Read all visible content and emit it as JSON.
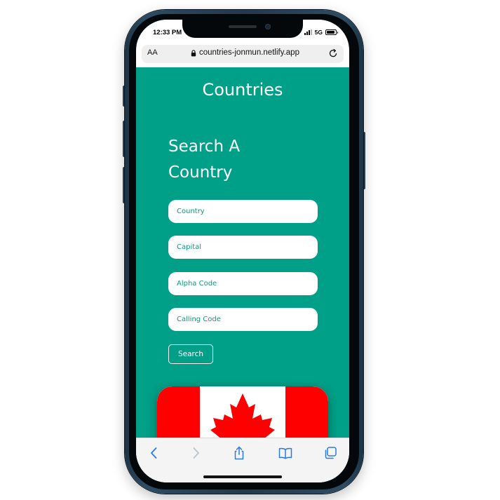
{
  "status_bar": {
    "time": "12:33 PM",
    "network": "5G",
    "signal_bars": 3,
    "battery_level": 0.9
  },
  "address_bar": {
    "reader_label": "AA",
    "url": "countries-jonmun.netlify.app",
    "lock_icon": "lock-icon",
    "reload_icon": "reload-icon"
  },
  "page": {
    "title": "Countries",
    "search_heading": "Search A Country",
    "fields": {
      "country_placeholder": "Country",
      "capital_placeholder": "Capital",
      "alpha_code_placeholder": "Alpha Code",
      "calling_code_placeholder": "Calling Code"
    },
    "search_button": "Search",
    "result_flag": "canada-flag"
  },
  "toolbar": {
    "back_icon": "chevron-left-icon",
    "forward_icon": "chevron-right-icon",
    "share_icon": "share-icon",
    "bookmarks_icon": "book-icon",
    "tabs_icon": "tabs-icon"
  },
  "colors": {
    "page_background": "#009f87",
    "accent_blue": "#2a7ae2",
    "flag_red": "#ff0000",
    "phone_frame": "#223a4e"
  }
}
